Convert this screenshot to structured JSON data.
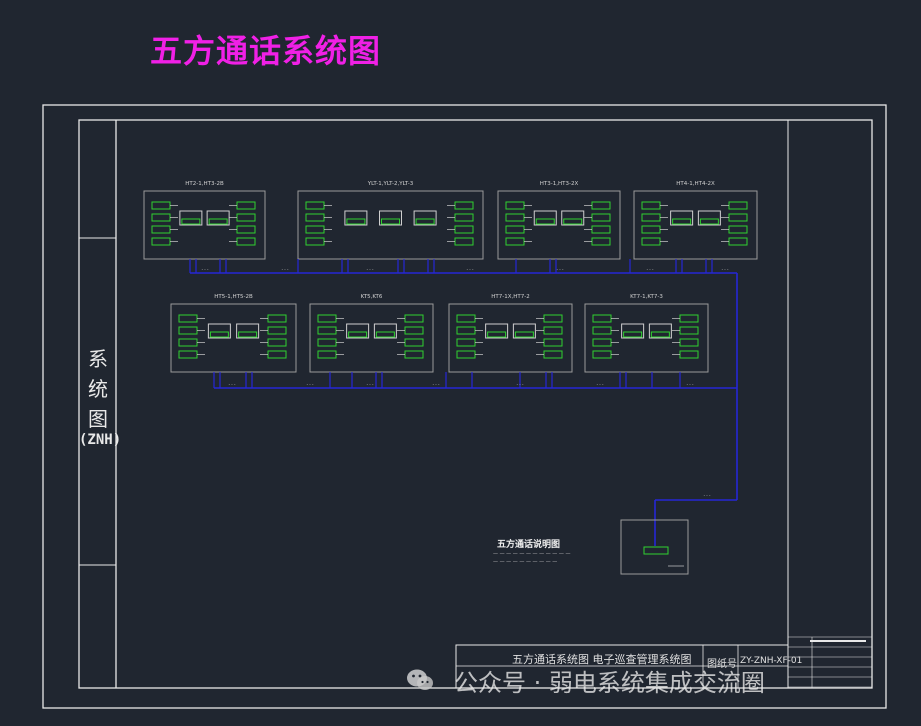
{
  "page": {
    "title": "五方通话系统图"
  },
  "side": {
    "chars": [
      "系",
      "统",
      "图"
    ],
    "code": "(ZNH)"
  },
  "groups": {
    "row1": [
      "HT2-1,HT3-2B",
      "YLT-1,YLT-2,YLT-3",
      "HT3-1,HT3-2X",
      "HT4-1,HT4-2X"
    ],
    "row2": [
      "HT5-1,HT5-2B",
      "KT5,KT6",
      "HT7-1X,HT7-2",
      "KT7-1,KT7-3"
    ]
  },
  "note": {
    "title": "五方通话说明图"
  },
  "title_block": {
    "drawing_name": "五方通话系统图 电子巡查管理系统图",
    "label_drawing_no": "图纸号",
    "drawing_no": "ZY-ZNH-XF-01"
  },
  "watermark": {
    "text": "公众号 · 弱电系统集成交流圈"
  },
  "colors": {
    "background": "#202630",
    "title": "#f020e6",
    "bus": "#2626d6",
    "device": "#2fd12f",
    "frame": "#e8e8e8"
  }
}
